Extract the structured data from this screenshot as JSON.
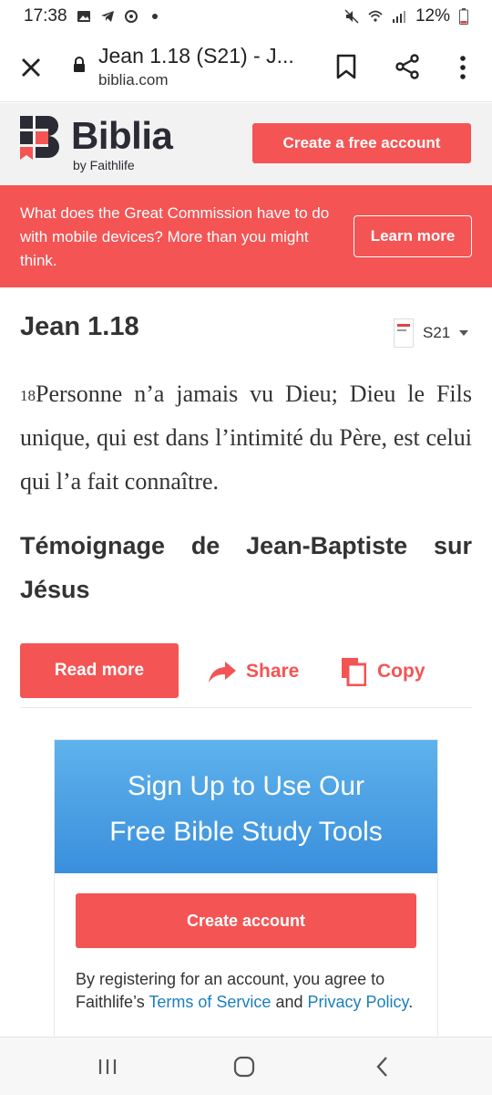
{
  "status_bar": {
    "time": "17:38",
    "battery": "12%"
  },
  "browser": {
    "title": "Jean 1.18 (S21) - J...",
    "url": "biblia.com"
  },
  "header": {
    "logo_word": "Biblia",
    "logo_sub": "by Faithlife",
    "create_free_label": "Create a free account"
  },
  "banner": {
    "text": "What does the Great Commission have to do with mobile devices? More than you might think.",
    "learn_more_label": "Learn more"
  },
  "passage": {
    "reference": "Jean 1.18",
    "version": "S21",
    "verse_number": "18",
    "verse_text": "Personne n’a jamais vu Dieu; Dieu le Fils unique, qui est dans l’intimité du Père, est celui qui l’a fait connaître.",
    "section_heading": "Témoignage de Jean-Baptiste sur Jésus"
  },
  "actions": {
    "read_more_label": "Read more",
    "share_label": "Share",
    "copy_label": "Copy"
  },
  "signup": {
    "title_line1": "Sign Up to Use Our",
    "title_line2": "Free Bible Study Tools",
    "create_account_label": "Create account",
    "terms_prefix": "By registering for an account, you agree to Faithlife’s ",
    "terms_link": "Terms of Service",
    "terms_and": " and ",
    "privacy_link": "Privacy Policy",
    "terms_suffix": "."
  },
  "colors": {
    "accent": "#f45454",
    "link": "#1a7fbf",
    "signup_blue": "#4aa0e3",
    "logo_dark": "#2b2b35"
  }
}
